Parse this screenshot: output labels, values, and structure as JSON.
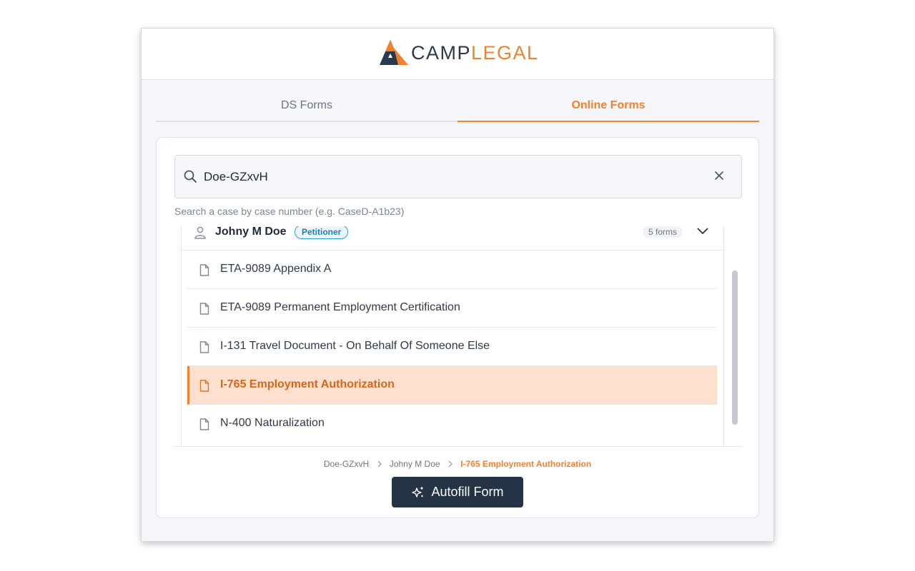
{
  "brand": {
    "name_part1": "CAMP",
    "name_part2": "LEGAL"
  },
  "tabs": [
    {
      "label": "DS Forms",
      "active": false
    },
    {
      "label": "Online Forms",
      "active": true
    }
  ],
  "search": {
    "value": "Doe-GZxvH",
    "hint": "Search a case by case number (e.g. CaseD-A1b23)"
  },
  "group": {
    "name": "Johny M Doe",
    "role": "Petitioner",
    "count_label": "5 forms"
  },
  "forms": [
    {
      "label": "ETA-9089 Appendix A"
    },
    {
      "label": "ETA-9089 Permanent Employment Certification"
    },
    {
      "label": "I-131 Travel Document - On Behalf Of Someone Else"
    },
    {
      "label": "I-765 Employment Authorization",
      "selected": true
    },
    {
      "label": "N-400 Naturalization"
    }
  ],
  "breadcrumb": {
    "case": "Doe-GZxvH",
    "person": "Johny M Doe",
    "form": "I-765 Employment Authorization"
  },
  "action": {
    "label": "Autofill Form"
  },
  "colors": {
    "accent": "#f0822e",
    "dark": "#243444",
    "selected_bg": "#fde0cd",
    "badge_blue": "#2f9bd6"
  },
  "icons": [
    "logo-triangle-icon",
    "search-icon",
    "close-icon",
    "user-icon",
    "chevron-down-icon",
    "document-icon",
    "chevron-right-icon",
    "sparkle-icon"
  ]
}
